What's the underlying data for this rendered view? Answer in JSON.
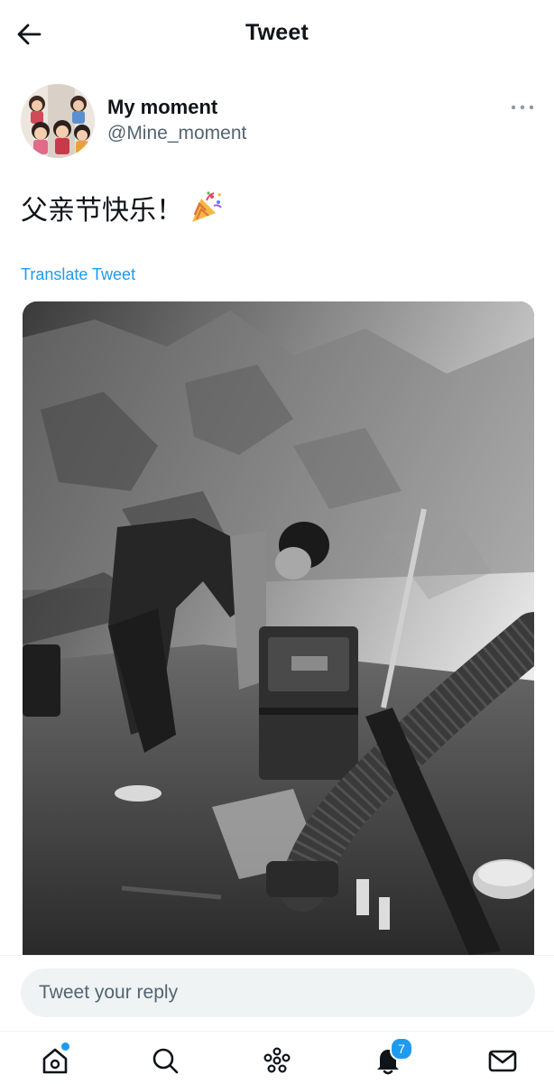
{
  "header": {
    "title": "Tweet",
    "back_icon": "arrow-left-icon"
  },
  "author": {
    "display_name": "My moment",
    "handle": "@Mine_moment",
    "more_icon": "more-horizontal-icon"
  },
  "tweet": {
    "text": "父亲节快乐！",
    "emoji_icon": "party-popper-icon",
    "translate_label": "Translate Tweet",
    "photo_icon": "photo-man-with-engine"
  },
  "reply": {
    "placeholder": "Tweet your reply"
  },
  "nav": {
    "items": [
      {
        "icon": "home-icon",
        "has_dot": true
      },
      {
        "icon": "search-icon"
      },
      {
        "icon": "spaces-icon"
      },
      {
        "icon": "bell-icon",
        "badge": "7"
      },
      {
        "icon": "mail-icon"
      }
    ]
  },
  "colors": {
    "accent": "#1d9bf0",
    "text": "#0f1419",
    "secondary": "#536471",
    "input_bg": "#eff3f4"
  }
}
